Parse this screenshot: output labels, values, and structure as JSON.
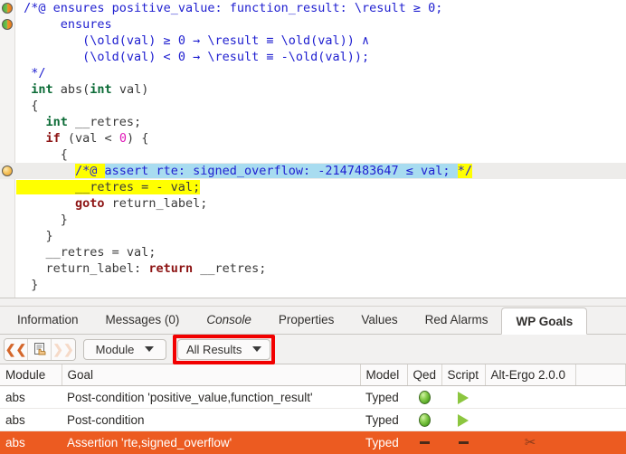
{
  "editor": {
    "lines": [
      {
        "gutter": "green-orange-bullet",
        "band": false,
        "tokens": [
          {
            "t": " ",
            "c": "punct"
          },
          {
            "t": "/*@ ensures positive_value: function_result: \\result ≥ 0;",
            "c": "acsl"
          }
        ]
      },
      {
        "gutter": "green-orange-bullet",
        "band": false,
        "tokens": [
          {
            "t": "      ",
            "c": "punct"
          },
          {
            "t": "ensures",
            "c": "acsl"
          }
        ]
      },
      {
        "gutter": "",
        "band": false,
        "tokens": [
          {
            "t": "         ",
            "c": "punct"
          },
          {
            "t": "(\\old(val) ≥ 0 → \\result ≡ \\old(val)) ∧",
            "c": "acsl"
          }
        ]
      },
      {
        "gutter": "",
        "band": false,
        "tokens": [
          {
            "t": "         ",
            "c": "punct"
          },
          {
            "t": "(\\old(val) < 0 → \\result ≡ -\\old(val));",
            "c": "acsl"
          }
        ]
      },
      {
        "gutter": "",
        "band": false,
        "tokens": [
          {
            "t": "  ",
            "c": "punct"
          },
          {
            "t": "*/",
            "c": "acsl"
          }
        ]
      },
      {
        "gutter": "",
        "band": false,
        "tokens": [
          {
            "t": "  ",
            "c": "punct"
          },
          {
            "t": "int",
            "c": "kw"
          },
          {
            "t": " abs(",
            "c": "id"
          },
          {
            "t": "int",
            "c": "kw"
          },
          {
            "t": " val)",
            "c": "id"
          }
        ]
      },
      {
        "gutter": "",
        "band": false,
        "tokens": [
          {
            "t": "  {",
            "c": "punct"
          }
        ]
      },
      {
        "gutter": "",
        "band": false,
        "tokens": [
          {
            "t": "    ",
            "c": "punct"
          },
          {
            "t": "int",
            "c": "kw"
          },
          {
            "t": " __retres;",
            "c": "id"
          }
        ]
      },
      {
        "gutter": "",
        "band": false,
        "tokens": [
          {
            "t": "    ",
            "c": "punct"
          },
          {
            "t": "if",
            "c": "ctl"
          },
          {
            "t": " (val < ",
            "c": "id"
          },
          {
            "t": "0",
            "c": "num"
          },
          {
            "t": ") {",
            "c": "id"
          }
        ]
      },
      {
        "gutter": "",
        "band": false,
        "tokens": [
          {
            "t": "      {",
            "c": "punct"
          }
        ]
      },
      {
        "gutter": "orange-bullet",
        "band": true,
        "tokens": [
          {
            "t": "        ",
            "c": "punct"
          },
          {
            "t": "/*@ ",
            "c": "acsl",
            "hl": "yellow"
          },
          {
            "t": "assert rte: signed_overflow: -2147483647 ≤ val; ",
            "c": "acsl",
            "hl": "cyan"
          },
          {
            "t": "*/",
            "c": "acsl",
            "hl": "yellow"
          }
        ]
      },
      {
        "gutter": "",
        "band": false,
        "tokens": [
          {
            "t": "        __retres = - val;",
            "c": "id",
            "hl": "yellow"
          }
        ]
      },
      {
        "gutter": "",
        "band": false,
        "tokens": [
          {
            "t": "        ",
            "c": "punct"
          },
          {
            "t": "goto",
            "c": "ctl"
          },
          {
            "t": " return_label;",
            "c": "id"
          }
        ]
      },
      {
        "gutter": "",
        "band": false,
        "tokens": [
          {
            "t": "      }",
            "c": "punct"
          }
        ]
      },
      {
        "gutter": "",
        "band": false,
        "tokens": [
          {
            "t": "    }",
            "c": "punct"
          }
        ]
      },
      {
        "gutter": "",
        "band": false,
        "tokens": [
          {
            "t": "    __retres = val;",
            "c": "id"
          }
        ]
      },
      {
        "gutter": "",
        "band": false,
        "tokens": [
          {
            "t": "    return_label: ",
            "c": "id"
          },
          {
            "t": "return",
            "c": "ctl"
          },
          {
            "t": " __retres;",
            "c": "id"
          }
        ]
      },
      {
        "gutter": "",
        "band": false,
        "tokens": [
          {
            "t": "  }",
            "c": "punct"
          }
        ]
      }
    ]
  },
  "tabs": [
    {
      "label": "Information",
      "active": false,
      "italic": false
    },
    {
      "label": "Messages (0)",
      "active": false,
      "italic": false
    },
    {
      "label": "Console",
      "active": false,
      "italic": true
    },
    {
      "label": "Properties",
      "active": false,
      "italic": false
    },
    {
      "label": "Values",
      "active": false,
      "italic": false
    },
    {
      "label": "Red Alarms",
      "active": false,
      "italic": false
    },
    {
      "label": "WP Goals",
      "active": true,
      "italic": false
    }
  ],
  "toolbar": {
    "back_icon": "double-chevron-left-icon",
    "pointer_icon": "document-hand-icon",
    "forward_icon": "double-chevron-right-icon",
    "scope_dropdown": "Module",
    "filter_dropdown": "All Results",
    "annotation_color": "#f20000"
  },
  "table": {
    "columns": [
      "Module",
      "Goal",
      "Model",
      "Qed",
      "Script",
      "Alt-Ergo 2.0.0",
      ""
    ],
    "rows": [
      {
        "module": "abs",
        "goal": "Post-condition 'positive_value,function_result'",
        "model": "Typed",
        "qed": "green-orb-icon",
        "script": "green-play-icon",
        "altergo": "",
        "selected": false
      },
      {
        "module": "abs",
        "goal": "Post-condition",
        "model": "Typed",
        "qed": "green-orb-icon",
        "script": "green-play-icon",
        "altergo": "",
        "selected": false
      },
      {
        "module": "abs",
        "goal": "Assertion 'rte,signed_overflow'",
        "model": "Typed",
        "qed": "dash-icon",
        "script": "dash-icon",
        "altergo": "scissors-icon",
        "selected": true
      }
    ]
  }
}
